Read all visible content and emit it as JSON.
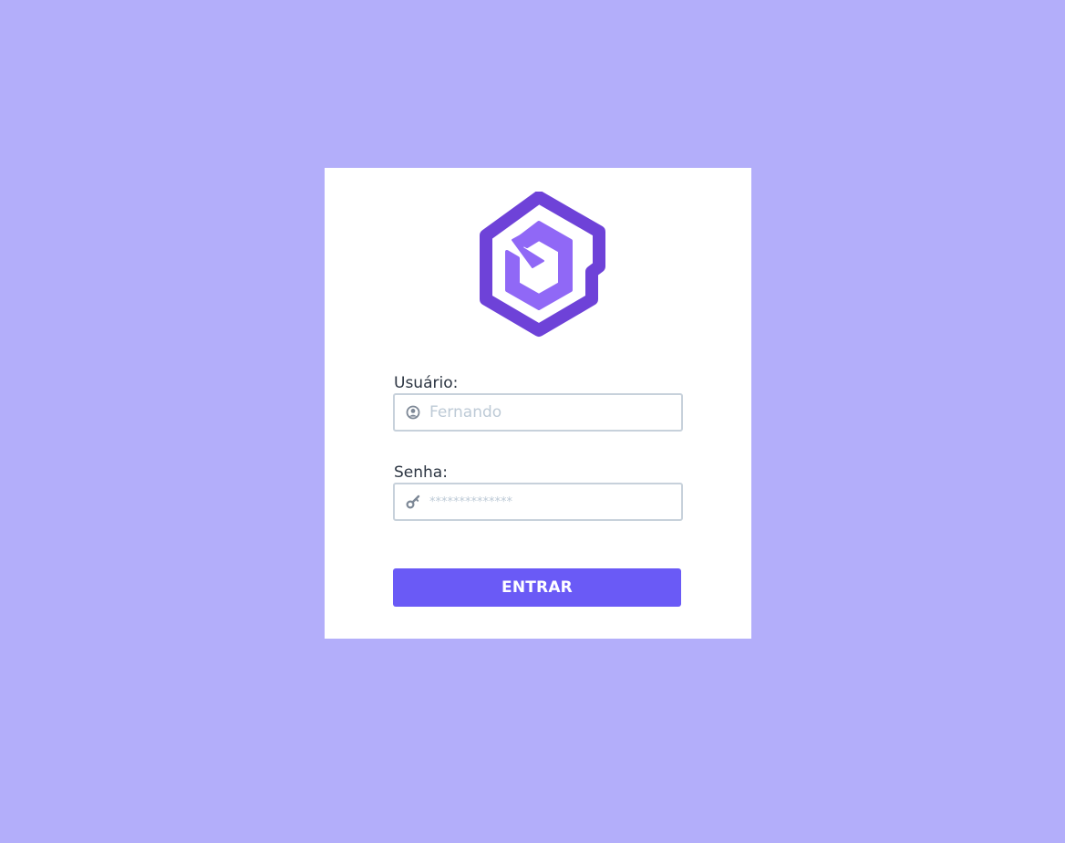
{
  "colors": {
    "background": "#b3aefa",
    "card": "#ffffff",
    "accent": "#6a5af6",
    "logo_outer": "#6e42d8",
    "logo_inner": "#9068f6",
    "input_border": "#c7d1db",
    "placeholder": "#bdcad6",
    "icon": "#7d8896"
  },
  "login": {
    "logo_icon": "hexagon-cube-logo",
    "username": {
      "label": "Usuário:",
      "placeholder": "Fernando",
      "value": "",
      "icon": "user-circle-icon"
    },
    "password": {
      "label": "Senha:",
      "placeholder": "**************",
      "value": "",
      "icon": "key-icon"
    },
    "submit_label": "ENTRAR"
  }
}
